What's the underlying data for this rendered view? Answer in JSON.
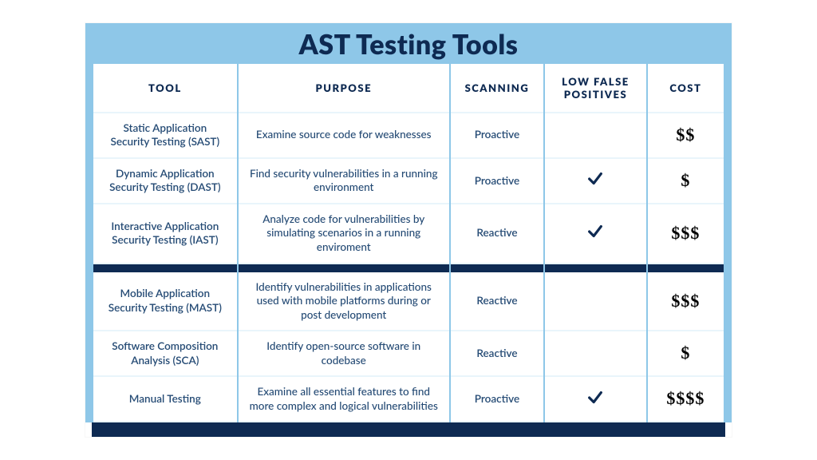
{
  "title": "AST Testing Tools",
  "columns": {
    "tool": "TOOL",
    "purpose": "PURPOSE",
    "scanning": "SCANNING",
    "low_false_positives": "LOW FALSE POSITIVES",
    "cost": "COST"
  },
  "rows": [
    {
      "tool": "Static Application Security Testing (SAST)",
      "purpose": "Examine source code for weaknesses",
      "scanning": "Proactive",
      "low_false_positives": false,
      "cost": "$$",
      "section_break_before": false
    },
    {
      "tool": "Dynamic Application Security Testing (DAST)",
      "purpose": "Find security vulnerabilities in a running environment",
      "scanning": "Proactive",
      "low_false_positives": true,
      "cost": "$",
      "section_break_before": false
    },
    {
      "tool": "Interactive Application Security Testing (IAST)",
      "purpose": "Analyze code for vulnerabilities by simulating scenarios in a running enviroment",
      "scanning": "Reactive",
      "low_false_positives": true,
      "cost": "$$$",
      "section_break_before": false
    },
    {
      "tool": "Mobile Application Security Testing (MAST)",
      "purpose": "Identify vulnerabilities in applications used with mobile platforms during or post development",
      "scanning": "Reactive",
      "low_false_positives": false,
      "cost": "$$$",
      "section_break_before": true
    },
    {
      "tool": "Software Composition Analysis (SCA)",
      "purpose": "Identify open-source software in codebase",
      "scanning": "Reactive",
      "low_false_positives": false,
      "cost": "$",
      "section_break_before": false
    },
    {
      "tool": "Manual Testing",
      "purpose": "Examine all essential features to find more complex and logical vulnerabilities",
      "scanning": "Proactive",
      "low_false_positives": true,
      "cost": "$$$$",
      "section_break_before": false
    }
  ],
  "chart_data": {
    "type": "table",
    "title": "AST Testing Tools",
    "columns": [
      "Tool",
      "Purpose",
      "Scanning",
      "Low False Positives",
      "Cost"
    ],
    "rows": [
      [
        "Static Application Security Testing (SAST)",
        "Examine source code for weaknesses",
        "Proactive",
        false,
        "$$"
      ],
      [
        "Dynamic Application Security Testing (DAST)",
        "Find security vulnerabilities in a running environment",
        "Proactive",
        true,
        "$"
      ],
      [
        "Interactive Application Security Testing (IAST)",
        "Analyze code for vulnerabilities by simulating scenarios in a running enviroment",
        "Reactive",
        true,
        "$$$"
      ],
      [
        "Mobile Application Security Testing (MAST)",
        "Identify vulnerabilities in applications used with mobile platforms during or post development",
        "Reactive",
        false,
        "$$$"
      ],
      [
        "Software Composition Analysis (SCA)",
        "Identify open-source software in codebase",
        "Reactive",
        false,
        "$"
      ],
      [
        "Manual Testing",
        "Examine all essential features to find more complex and logical vulnerabilities",
        "Proactive",
        true,
        "$$$$"
      ]
    ]
  }
}
